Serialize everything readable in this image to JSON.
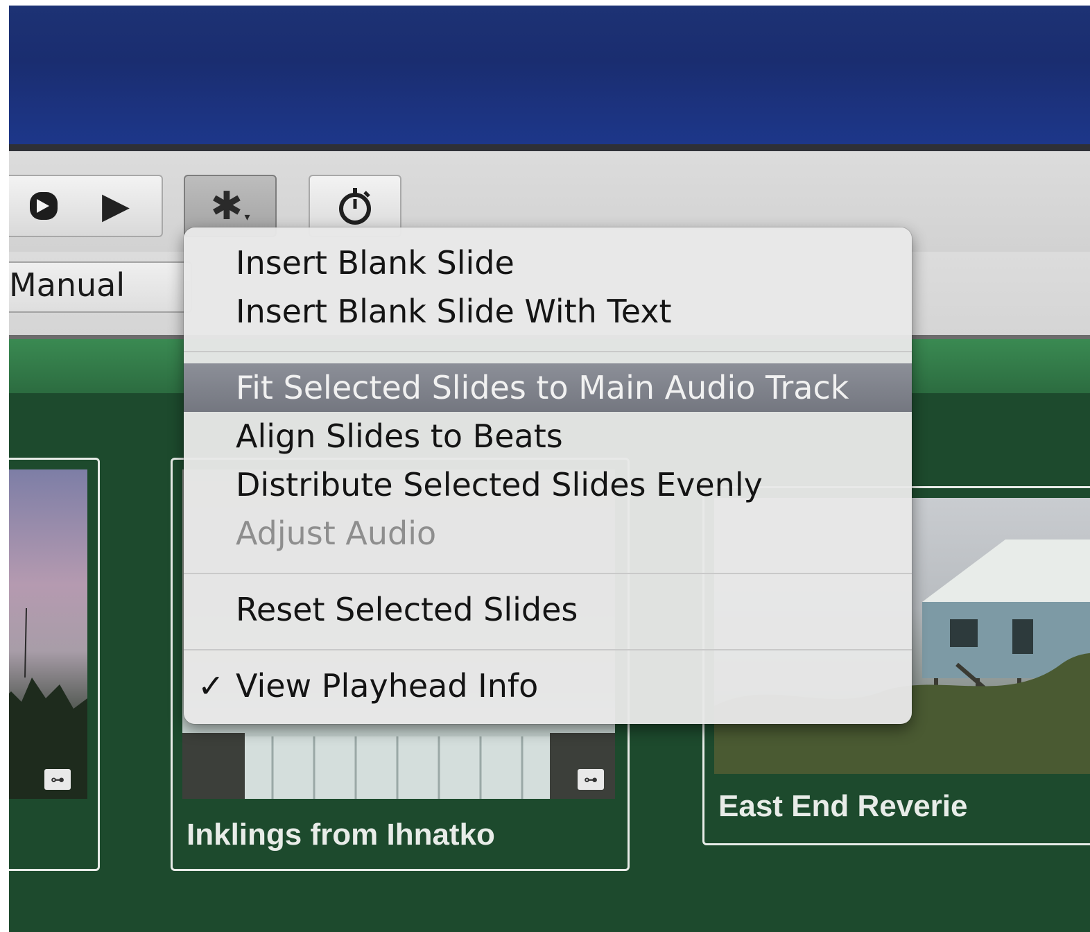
{
  "toolbar": {
    "rewind_icon": "rewind-icon",
    "play_icon": "play-icon",
    "play_glyph": "▶",
    "gear_icon": "gear-icon",
    "gear_glyph": "✱",
    "gear_caret": "▾",
    "timer_icon": "stopwatch-icon",
    "manual_label": "Manual"
  },
  "menu": {
    "items": [
      {
        "label": "Insert Blank Slide",
        "state": "normal"
      },
      {
        "label": "Insert Blank Slide With Text",
        "state": "normal"
      },
      {
        "label": "Fit Selected Slides to Main Audio Track",
        "state": "highlighted"
      },
      {
        "label": "Align Slides to Beats",
        "state": "normal"
      },
      {
        "label": "Distribute Selected Slides Evenly",
        "state": "normal"
      },
      {
        "label": "Adjust Audio",
        "state": "disabled"
      },
      {
        "label": "Reset Selected Slides",
        "state": "normal"
      },
      {
        "label": "View Playhead Info",
        "state": "checked",
        "checkmark": "✓"
      }
    ]
  },
  "slides": [
    {
      "label": ""
    },
    {
      "label": "Inklings from Ihnatko"
    },
    {
      "label": "East End Reverie"
    }
  ],
  "badge_glyph": "⊶",
  "colors": {
    "viewer_blue": "#1d3274",
    "slide_bg": "#1d4a2d",
    "menu_highlight": "#80838c"
  }
}
